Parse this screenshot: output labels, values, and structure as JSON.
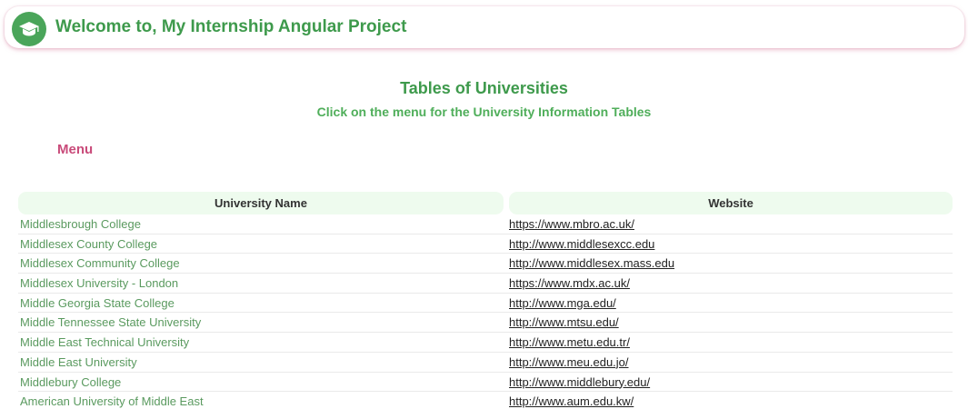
{
  "header": {
    "title": "Welcome to, My Internship Angular Project",
    "logo_icon": "graduation-cap-icon",
    "brand_color": "#4aa55a"
  },
  "main": {
    "title": "Tables of Universities",
    "subtitle": "Click on the menu for the University Information Tables",
    "menu_label": "Menu"
  },
  "table": {
    "columns": [
      "University Name",
      "Website"
    ],
    "rows": [
      {
        "name": "Middlesbrough College",
        "website": "https://www.mbro.ac.uk/"
      },
      {
        "name": "Middlesex County College",
        "website": "http://www.middlesexcc.edu"
      },
      {
        "name": "Middlesex Community College",
        "website": "http://www.middlesex.mass.edu"
      },
      {
        "name": "Middlesex University - London",
        "website": "https://www.mdx.ac.uk/"
      },
      {
        "name": "Middle Georgia State College",
        "website": "http://www.mga.edu/"
      },
      {
        "name": "Middle Tennessee State University",
        "website": "http://www.mtsu.edu/"
      },
      {
        "name": "Middle East Technical University",
        "website": "http://www.metu.edu.tr/"
      },
      {
        "name": "Middle East University",
        "website": "http://www.meu.edu.jo/"
      },
      {
        "name": "Middlebury College",
        "website": "http://www.middlebury.edu/"
      },
      {
        "name": "American University of Middle East",
        "website": "http://www.aum.edu.kw/"
      }
    ]
  },
  "colors": {
    "heading_green": "#3e9a4c",
    "menu_pink": "#c94b7a",
    "header_bg": "#eefbee"
  }
}
